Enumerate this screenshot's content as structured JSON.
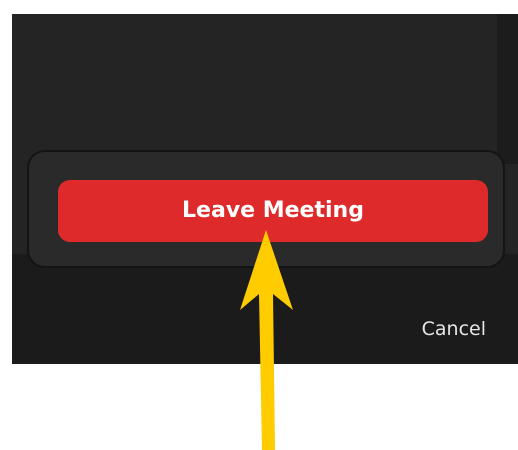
{
  "dialog": {
    "leave_label": "Leave Meeting",
    "cancel_label": "Cancel"
  },
  "colors": {
    "window_bg": "#242424",
    "popup_bg": "#2a2a2a",
    "leave_button": "#de2a2a",
    "arrow": "#ffcc00"
  },
  "annotation": {
    "icon": "arrow-up-icon"
  }
}
